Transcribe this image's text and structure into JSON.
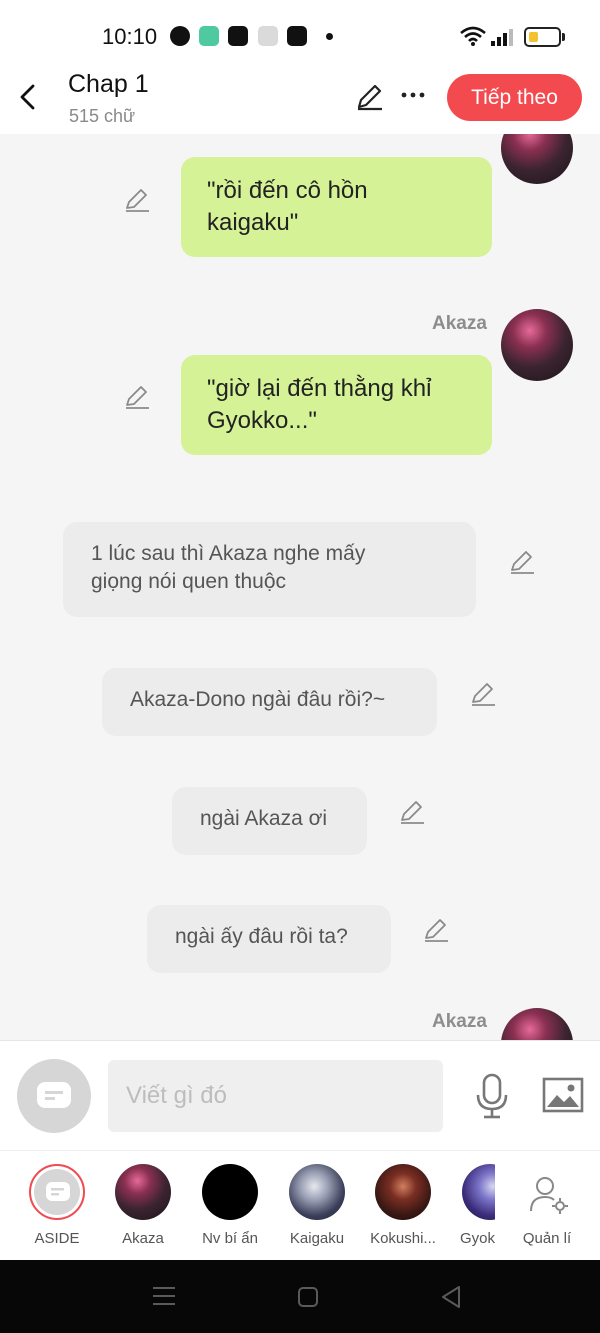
{
  "status_bar": {
    "time": "10:10",
    "battery_level": 0.35
  },
  "header": {
    "title": "Chap 1",
    "word_count": "515 chữ",
    "next_button": "Tiếp theo"
  },
  "messages": [
    {
      "type": "character",
      "text_lines": [
        "\"rồi đến cô hồn",
        "kaigaku\""
      ]
    },
    {
      "type": "character",
      "speaker": "Akaza",
      "text_lines": [
        "\"giờ lại đến thằng khỉ",
        "Gyokko...\""
      ]
    },
    {
      "type": "narration",
      "text_lines": [
        "1 lúc sau thì Akaza nghe mấy",
        "giọng nói quen thuộc"
      ]
    },
    {
      "type": "narration",
      "text_lines": [
        "Akaza-Dono ngài đâu rồi?~"
      ]
    },
    {
      "type": "narration",
      "text_lines": [
        "ngài Akaza ơi"
      ]
    },
    {
      "type": "narration",
      "text_lines": [
        "ngài ấy đâu rồi ta?"
      ]
    },
    {
      "type": "character",
      "speaker": "Akaza"
    }
  ],
  "composer": {
    "placeholder": "Viết gì đó"
  },
  "characters": [
    {
      "name": "ASIDE"
    },
    {
      "name": "Akaza"
    },
    {
      "name": "Nv bí ẩn"
    },
    {
      "name": "Kaigaku"
    },
    {
      "name": "Kokushi..."
    },
    {
      "name": "Gyok"
    },
    {
      "name": "Quản lí"
    }
  ],
  "colors": {
    "accent": "#f34a50",
    "bubble_green": "#d5f296",
    "bubble_gray": "#ececec"
  }
}
